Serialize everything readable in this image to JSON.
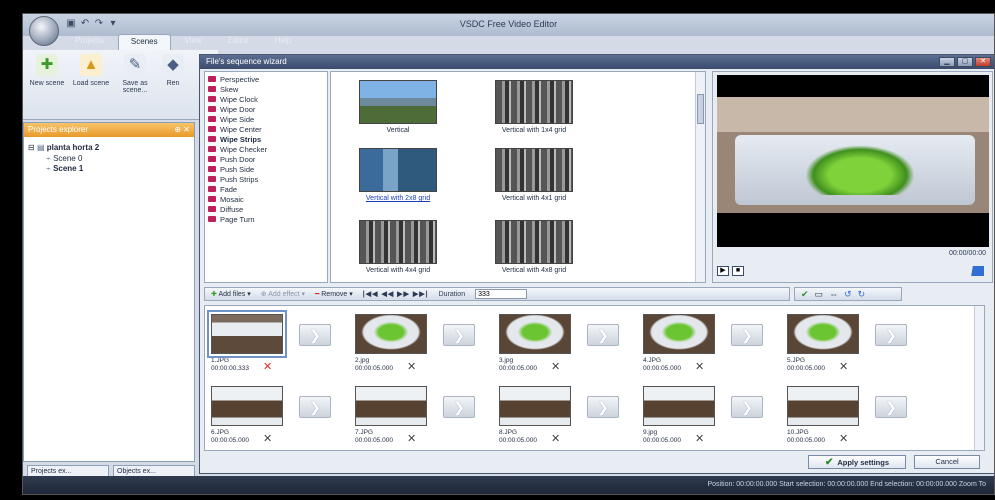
{
  "app": {
    "title": "VSDC Free Video Editor"
  },
  "ribbon": {
    "tabs": [
      "Projects",
      "Scenes",
      "View",
      "Editor",
      "Help"
    ],
    "buttons": [
      {
        "label": "New scene",
        "icon": "add-scene-icon"
      },
      {
        "label": "Load scene",
        "icon": "load-scene-icon"
      },
      {
        "label": "Save as scene...",
        "icon": "save-scene-icon"
      },
      {
        "label": "Ren",
        "icon": "rename-icon"
      }
    ]
  },
  "explorer": {
    "title": "Projects explorer",
    "project": "planta horta 2",
    "scenes": [
      "Scene 0",
      "Scene 1"
    ]
  },
  "bottom_tabs": [
    "Projects ex...",
    "Objects ex..."
  ],
  "statusbar": {
    "text": "Position: 00:00:00.000   Start selection: 00:00:00.000   End selection: 00:00:00.000   Zoom To"
  },
  "dialog": {
    "title": "File's sequence wizard",
    "effects": [
      "Perspective",
      "Skew",
      "Wipe Clock",
      "Wipe Door",
      "Wipe Side",
      "Wipe Center",
      "Wipe Strips",
      "Wipe Checker",
      "Push Door",
      "Push Side",
      "Push Strips",
      "Fade",
      "Mosaic",
      "Diffuse",
      "Page Turn"
    ],
    "selected_effect": "Wipe Strips",
    "variants": [
      "Vertical",
      "Vertical with 1x4 grid",
      "Vertical with 2x8 grid",
      "Vertical with 4x1 grid",
      "Vertical with 4x4 grid",
      "Vertical with 4x8 grid"
    ],
    "preview_time": "00:00/00:00",
    "toolbar": {
      "add_files": "Add files",
      "add_effect": "Add effect",
      "remove": "Remove",
      "nav": "|◀◀  ◀◀  ▶▶  ▶▶|",
      "duration_label": "Duration",
      "duration_value": "333"
    },
    "slides": [
      {
        "name": "1.JPG",
        "time": "00:00:00.333"
      },
      {
        "name": "2.jpg",
        "time": "00:00:05.000"
      },
      {
        "name": "3.jpg",
        "time": "00:00:05.000"
      },
      {
        "name": "4.JPG",
        "time": "00:00:05.000"
      },
      {
        "name": "5.JPG",
        "time": "00:00:05.000"
      },
      {
        "name": "6.JPG",
        "time": "00:00:05.000"
      },
      {
        "name": "7.JPG",
        "time": "00:00:05.000"
      },
      {
        "name": "8.JPG",
        "time": "00:00:05.000"
      },
      {
        "name": "9.jpg",
        "time": "00:00:05.000"
      },
      {
        "name": "10.JPG",
        "time": "00:00:05.000"
      }
    ],
    "apply_label": "Apply settings",
    "cancel_label": "Cancel"
  },
  "colors": {
    "accent": "#e99a2a",
    "effect_swatch": "#c0205a",
    "link": "#1a3dbd"
  }
}
